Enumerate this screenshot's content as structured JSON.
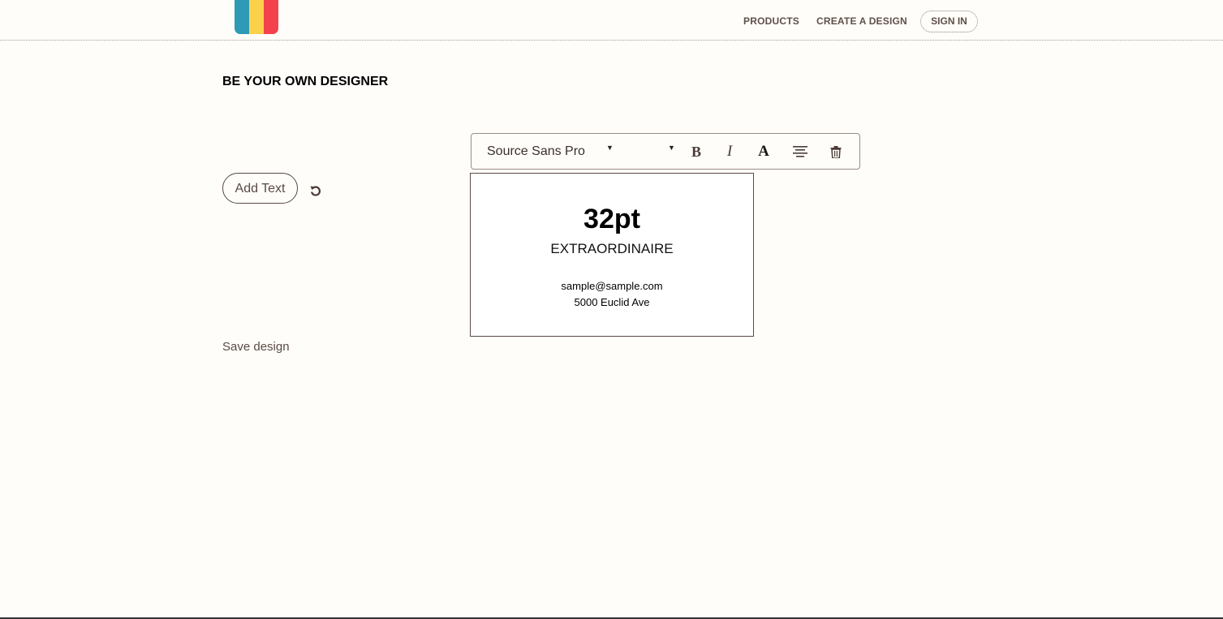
{
  "brand": {
    "logo_colors": [
      "#2e9ab5",
      "#fbd14b",
      "#f4424c"
    ]
  },
  "nav": {
    "products": "PRODUCTS",
    "create_design": "CREATE A DESIGN",
    "sign_in": "SIGN IN"
  },
  "page": {
    "title": "BE YOUR OWN DESIGNER"
  },
  "actions": {
    "add_text": "Add Text",
    "undo_icon": "undo-icon",
    "save_design": "Save design"
  },
  "toolbar": {
    "font_family": "Source Sans Pro",
    "size_caret": "▾",
    "bold_label": "B",
    "italic_label": "I",
    "color_label": "A",
    "icons": [
      "bold-icon",
      "italic-icon",
      "font-color-icon",
      "align-center-icon",
      "trash-icon"
    ]
  },
  "card": {
    "headline": "32pt",
    "subtitle": "EXTRAORDINAIRE",
    "email": "sample@sample.com",
    "address": "5000 Euclid Ave"
  }
}
